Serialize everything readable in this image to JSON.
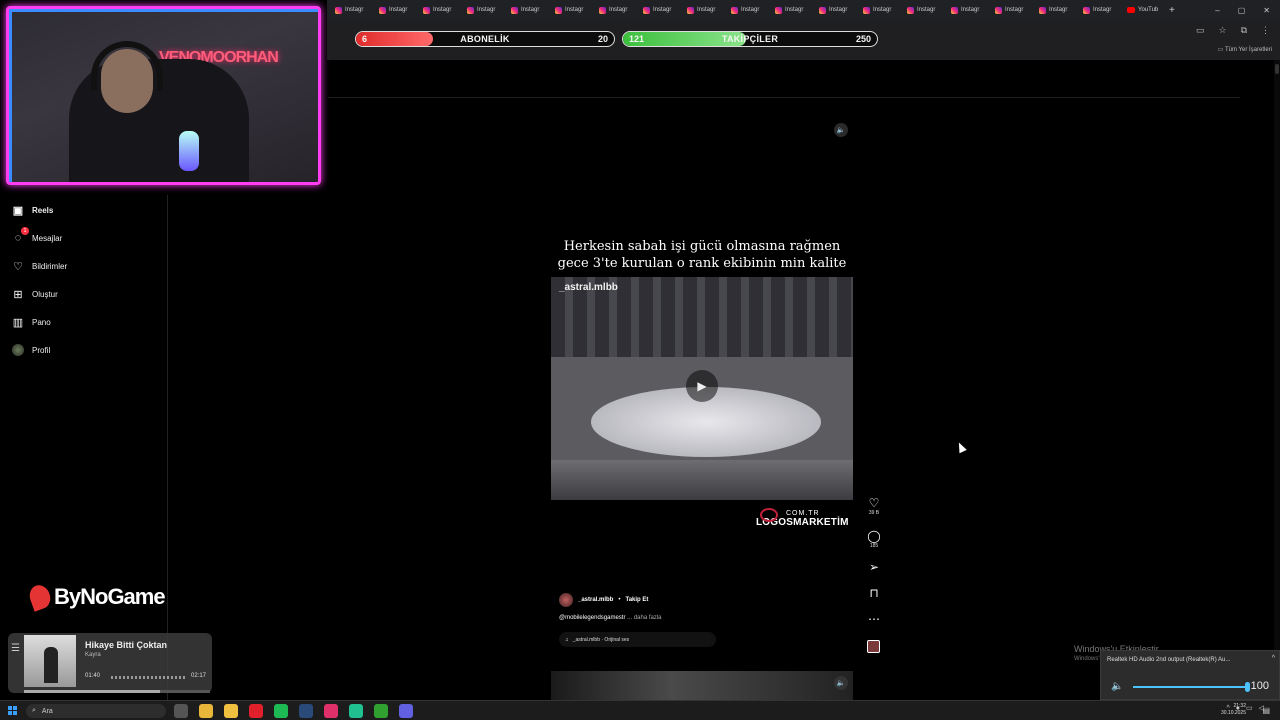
{
  "stream_overlay": {
    "webcam_neon_text": "VENOMOORHAN",
    "brand": "ByNoGame",
    "subscriber_bar": {
      "current": "6",
      "label": "ABONELİK",
      "goal": "20",
      "fraction": 0.3,
      "color": "#e02b2b"
    },
    "follower_bar": {
      "current": "121",
      "label": "TAKİPÇİLER",
      "goal": "250",
      "fraction": 0.484,
      "color": "#3cbf3c"
    }
  },
  "browser": {
    "tabs": [
      {
        "label": "Instagr",
        "icon": "instagram-icon"
      },
      {
        "label": "Instagr",
        "icon": "instagram-icon"
      },
      {
        "label": "Instagr",
        "icon": "instagram-icon"
      },
      {
        "label": "Instagr",
        "icon": "instagram-icon"
      },
      {
        "label": "Instagr",
        "icon": "instagram-icon"
      },
      {
        "label": "Instagr",
        "icon": "instagram-icon"
      },
      {
        "label": "Instagr",
        "icon": "instagram-icon"
      },
      {
        "label": "Instagr",
        "icon": "instagram-icon"
      },
      {
        "label": "Instagr",
        "icon": "instagram-icon"
      },
      {
        "label": "Instagr",
        "icon": "instagram-icon"
      },
      {
        "label": "Instagr",
        "icon": "instagram-icon"
      },
      {
        "label": "Instagr",
        "icon": "instagram-icon"
      },
      {
        "label": "Instagr",
        "icon": "instagram-icon"
      },
      {
        "label": "Instagr",
        "icon": "instagram-icon"
      },
      {
        "label": "Instagr",
        "icon": "instagram-icon"
      },
      {
        "label": "Instagr",
        "icon": "instagram-icon"
      },
      {
        "label": "Instagr",
        "icon": "instagram-icon"
      },
      {
        "label": "Instagr",
        "icon": "instagram-icon"
      },
      {
        "label": "YouTub",
        "icon": "youtube-icon"
      }
    ],
    "new_tab": "+",
    "window_controls": {
      "minimize": "–",
      "maximize": "▢",
      "close": "✕"
    },
    "bookmarks_label": "Tüm Yer İşaretleri"
  },
  "sidebar": {
    "items": [
      {
        "label": "Reels",
        "icon": "reels-icon",
        "glyph": "▣",
        "active": true
      },
      {
        "label": "Mesajlar",
        "icon": "messenger-icon",
        "glyph": "◌",
        "badge": "1"
      },
      {
        "label": "Bildirimler",
        "icon": "heart-icon",
        "glyph": "♡"
      },
      {
        "label": "Oluştur",
        "icon": "create-icon",
        "glyph": "⊞"
      },
      {
        "label": "Pano",
        "icon": "dashboard-icon",
        "glyph": "▥"
      },
      {
        "label": "Profil",
        "icon": "profile-avatar-icon",
        "glyph": ""
      }
    ]
  },
  "reel": {
    "caption_line1": "Herkesin sabah işi gücü olmasına rağmen",
    "caption_line2": "gece 3'te kurulan o rank ekibinin min kalite",
    "video_watermark": "_astral.mlbb",
    "overlay_logo_domain": "COM.TR",
    "overlay_logo_name": "LOGOSMARKETİM",
    "likes": "39 B",
    "comments": "185",
    "username": "_astral.mlbb",
    "separator": "•",
    "follow_label": "Takip Et",
    "description": "@mobilelegendsgamestr",
    "description_more": "... daha fazla",
    "audio": "_astral.mlbb · Orijinal ses"
  },
  "music_player": {
    "title": "Hikaye Bitti Çoktan",
    "artist": "Kayra",
    "elapsed": "01:40",
    "duration": "02:17",
    "progress": 0.73
  },
  "windows_watermark": {
    "line1": "Windows'u Etkinleştir",
    "line2": "Windows'u etkinleştirmek için Ayarlar'a gidin."
  },
  "volume_popup": {
    "device": "Realtek HD Audio 2nd output (Realtek(R) Au...",
    "value": "100",
    "level": 1.0
  },
  "taskbar": {
    "search_placeholder": "Ara",
    "time": "21:32",
    "date": "30.10.2025",
    "apps": [
      {
        "icon": "task-view-icon",
        "color": "#555"
      },
      {
        "icon": "chrome-icon",
        "color": "#e8b73a"
      },
      {
        "icon": "file-explorer-icon",
        "color": "#f0c040"
      },
      {
        "icon": "opera-icon",
        "color": "#e0202a"
      },
      {
        "icon": "spotify-icon",
        "color": "#1db954"
      },
      {
        "icon": "steam-icon",
        "color": "#2a4a7a"
      },
      {
        "icon": "streamlabs-icon",
        "color": "#e0306a"
      },
      {
        "icon": "media-icon",
        "color": "#20c090"
      },
      {
        "icon": "xbox-icon",
        "color": "#30a030"
      },
      {
        "icon": "discord-icon",
        "color": "#6060e0"
      }
    ]
  },
  "colors": {
    "accent_pink": "#ff3df2",
    "accent_blue": "#3c8bff",
    "like_red": "#ff3040"
  }
}
